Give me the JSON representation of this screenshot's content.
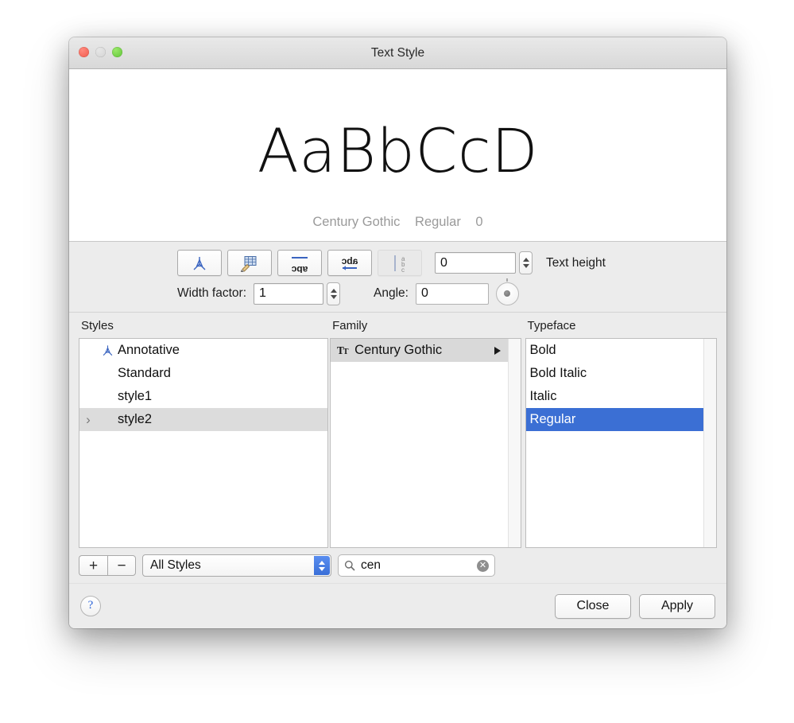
{
  "window": {
    "title": "Text Style",
    "traffic_lights": [
      "close-button",
      "minimize-button",
      "zoom-button"
    ]
  },
  "preview": {
    "sample_text": "AaBbCcD",
    "font_family": "Century Gothic",
    "font_style": "Regular",
    "font_size": "0"
  },
  "toolbar": {
    "buttons": [
      {
        "name": "annotative-button",
        "icon": "annotative-icon",
        "label": "Annotative",
        "state": "enabled"
      },
      {
        "name": "match-orientation-button",
        "icon": "match-text-orientation-icon",
        "label": "Match text orientation to layout",
        "state": "enabled"
      },
      {
        "name": "upside-down-button",
        "icon": "upside-down-text-icon",
        "label": "Upside down",
        "state": "enabled"
      },
      {
        "name": "backwards-button",
        "icon": "backwards-text-icon",
        "label": "Backwards",
        "state": "enabled"
      },
      {
        "name": "vertical-button",
        "icon": "vertical-text-icon",
        "label": "Vertical",
        "state": "disabled"
      }
    ],
    "text_height": {
      "label": "Text height",
      "value": "0"
    },
    "width_factor": {
      "label": "Width factor:",
      "value": "1"
    },
    "angle": {
      "label": "Angle:",
      "value": "0"
    }
  },
  "styles_panel": {
    "header": "Styles",
    "items": [
      {
        "label": "Annotative",
        "icon": "annotative-icon",
        "selected": false,
        "expandable": false
      },
      {
        "label": "Standard",
        "icon": "",
        "selected": false,
        "expandable": false
      },
      {
        "label": "style1",
        "icon": "",
        "selected": false,
        "expandable": false
      },
      {
        "label": "style2",
        "icon": "",
        "selected": true,
        "expandable": true
      }
    ]
  },
  "family_panel": {
    "header": "Family",
    "items": [
      {
        "label": "Century Gothic",
        "icon": "truetype-icon",
        "selected": true,
        "expandable": true
      }
    ]
  },
  "typeface_panel": {
    "header": "Typeface",
    "items": [
      {
        "label": "Bold",
        "selected": false
      },
      {
        "label": "Bold Italic",
        "selected": false
      },
      {
        "label": "Italic",
        "selected": false
      },
      {
        "label": "Regular",
        "selected": true
      }
    ]
  },
  "bottom_bar": {
    "add_label": "+",
    "remove_label": "−",
    "filter_value": "All Styles",
    "search": {
      "value": "cen",
      "placeholder": "Search",
      "clear_label": "✕"
    }
  },
  "footer": {
    "help_label": "?",
    "close_label": "Close",
    "apply_label": "Apply"
  },
  "colors": {
    "selection_blue": "#3b6fd4",
    "selection_gray": "#dcdcdc",
    "window_bg": "#ececec",
    "accent_blue": "#2a63d8"
  }
}
